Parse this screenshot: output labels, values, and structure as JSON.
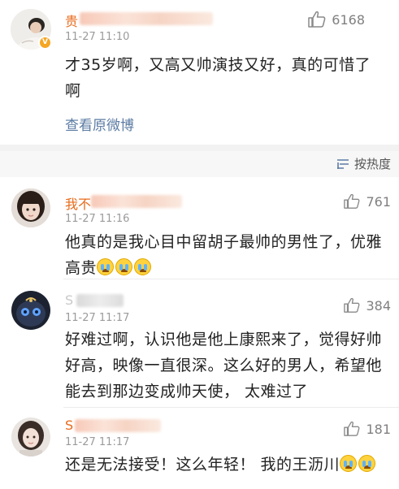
{
  "post": {
    "author_name_visible": "贵",
    "time": "11-27 11:10",
    "likes": "6168",
    "text": "才35岁啊，又高又帅演技又好，真的可惜了啊",
    "view_original_link": "查看原微博"
  },
  "sort": {
    "label": "按热度",
    "icon": "sort-icon"
  },
  "comments": [
    {
      "name_visible": "我不",
      "time": "11-27 11:16",
      "likes": "761",
      "text": "他真的是我心目中留胡子最帅的男性了，优雅高贵",
      "emoji_count": 3,
      "emoji_name": "crying-face"
    },
    {
      "name_visible": "S",
      "time": "11-27 11:17",
      "likes": "384",
      "text": "好难过啊，认识他是他上康熙来了，觉得好帅好高，映像一直很深。这么好的男人，希望他能去到那边变成帅天使， 太难过了"
    },
    {
      "name_visible": "S",
      "time": "11-27 11:17",
      "likes": "181",
      "text": "还是无法接受！这么年轻！ 我的王沥川",
      "emoji_count": 2,
      "emoji_name": "crying-face"
    }
  ],
  "colors": {
    "name": "#e86a1a",
    "link": "#5b7ba3",
    "verified_badge": "#f5a623"
  }
}
